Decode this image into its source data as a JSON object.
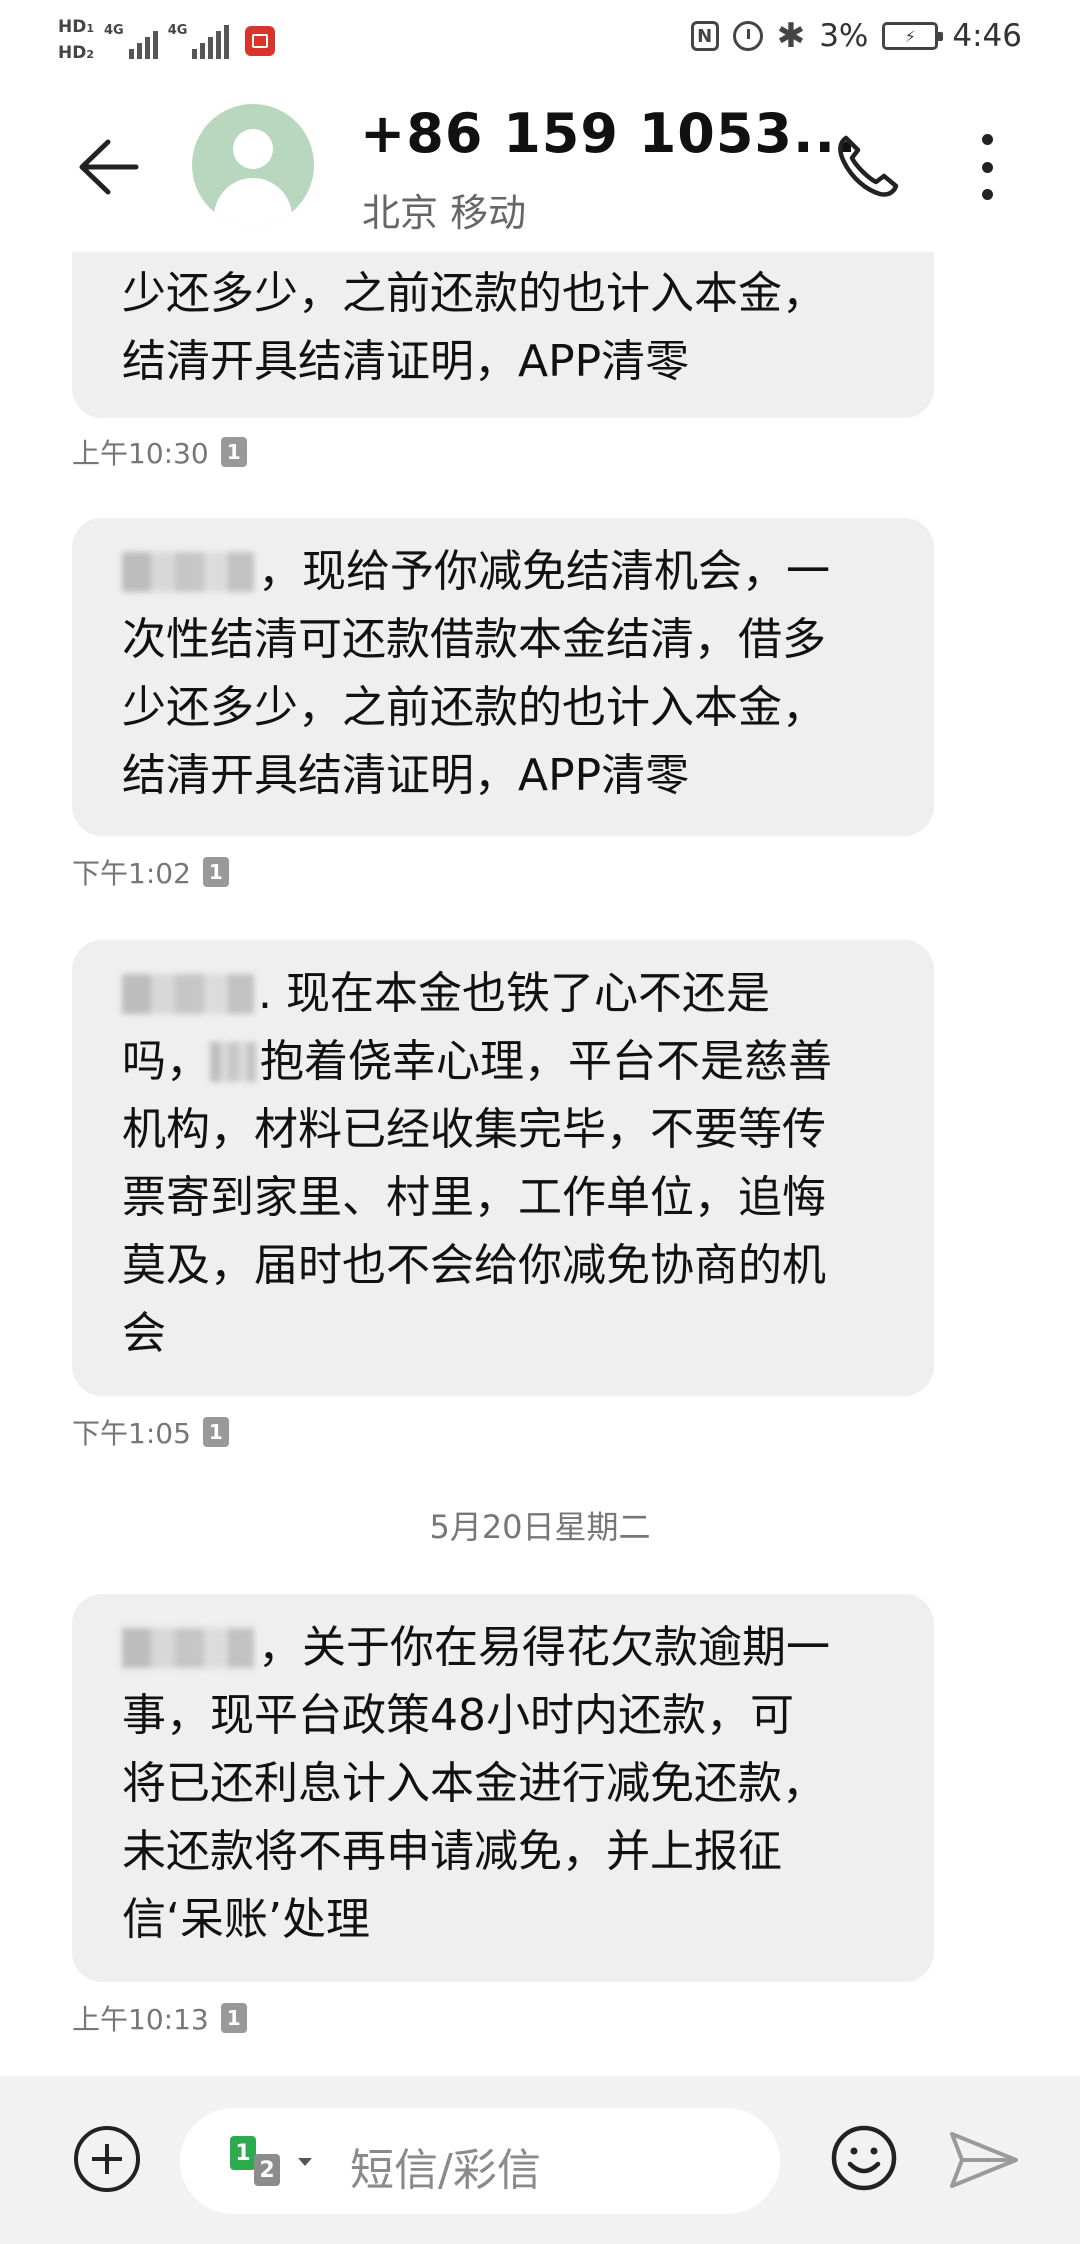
{
  "status_bar": {
    "hd1": "HD",
    "hd1_sub": "1",
    "hd2": "HD",
    "hd2_sub": "2",
    "network1": "4G",
    "network2": "4G",
    "nfc_label": "N",
    "battery_percent": "3%",
    "time": "4:46"
  },
  "header": {
    "contact_name": "+86 159 1053...",
    "contact_sub": "北京 移动",
    "icons": [
      "back-arrow-icon",
      "avatar",
      "phone-icon",
      "more-vertical-icon"
    ]
  },
  "messages": [
    {
      "lines": [
        "少还多少，之前还款的也计入本金，",
        "结清开具结清证明，APP清零"
      ],
      "time": "上午10:30",
      "sim": "1"
    },
    {
      "lines": [
        "，现给予你减免结清机会，一",
        "次性结清可还款借款本金结清，借多",
        "少还多少，之前还款的也计入本金，",
        "结清开具结清证明，APP清零"
      ],
      "time": "下午1:02",
      "sim": "1"
    },
    {
      "lines": ". 现在本金也铁了心不还是|吗，|抱着侥幸心理，平台不是慈善|机构，材料已经收集完毕，不要等传|票寄到家里、村里，工作单位，追悔|莫及，届时也不会给你减免协商的机|会",
      "line1_after_blur": ". 现在本金也铁了心不还是",
      "line2_before_blur": "吗，",
      "line2_after_blur": "抱着侥幸心理，平台不是慈善",
      "rest": [
        "机构，材料已经收集完毕，不要等传",
        "票寄到家里、村里，工作单位，追悔",
        "莫及，届时也不会给你减免协商的机",
        "会"
      ],
      "time": "下午1:05",
      "sim": "1"
    },
    {
      "lines": [
        "，关于你在易得花欠款逾期一",
        "事，现平台政策48小时内还款，可",
        "将已还利息计入本金进行减免还款，",
        "未还款将不再申请减免，并上报征",
        "信‘呆账’处理"
      ],
      "time": "上午10:13",
      "sim": "1"
    }
  ],
  "date_separator": "5月20日星期二",
  "input_bar": {
    "sim_primary": "1",
    "sim_secondary": "2",
    "placeholder": "短信/彩信"
  },
  "colors": {
    "bubble_bg": "#efefef",
    "avatar_bg": "#b9d6bf",
    "sim_green": "#2daa4e"
  }
}
